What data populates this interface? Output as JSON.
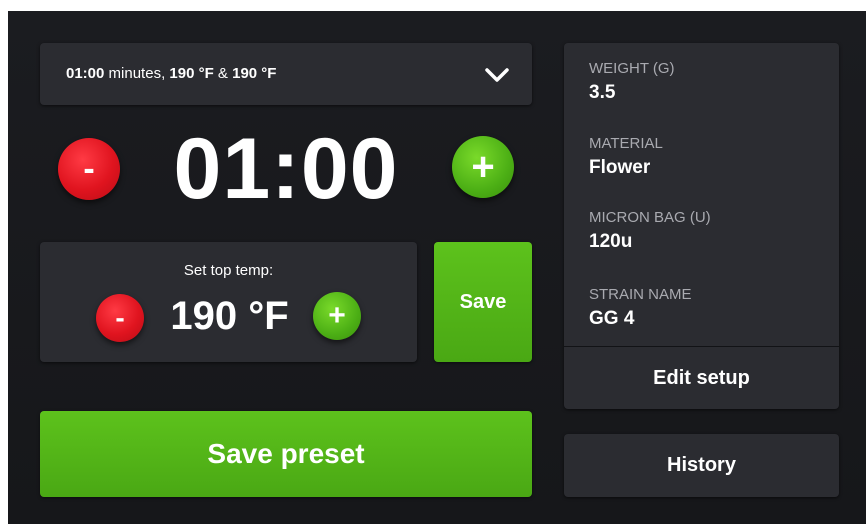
{
  "preset": {
    "time": "01:00",
    "time_unit": " minutes, ",
    "top_temp": "190 °F",
    "joiner": " & ",
    "bottom_temp": "190 °F",
    "chevron_icon": "chevron-down-icon"
  },
  "timer": {
    "minus_label": "-",
    "display": "01:00",
    "plus_label": "+"
  },
  "temperature": {
    "label": "Set top temp:",
    "minus_label": "-",
    "value": "190 °F",
    "plus_label": "+",
    "save_label": "Save"
  },
  "save_preset_label": "Save preset",
  "setup": {
    "weight_key": "WEIGHT (G)",
    "weight_value": "3.5",
    "material_key": "MATERIAL",
    "material_value": "Flower",
    "micron_key": "MICRON BAG (U)",
    "micron_value": "120u",
    "strain_key": "STRAIN NAME",
    "strain_value": "GG 4",
    "edit_label": "Edit setup"
  },
  "history_label": "History",
  "colors": {
    "background": "#17181b",
    "panel": "#2b2c31",
    "accent_green": "#4eab15",
    "accent_red": "#e0141f",
    "muted_text": "#a9aab0"
  }
}
